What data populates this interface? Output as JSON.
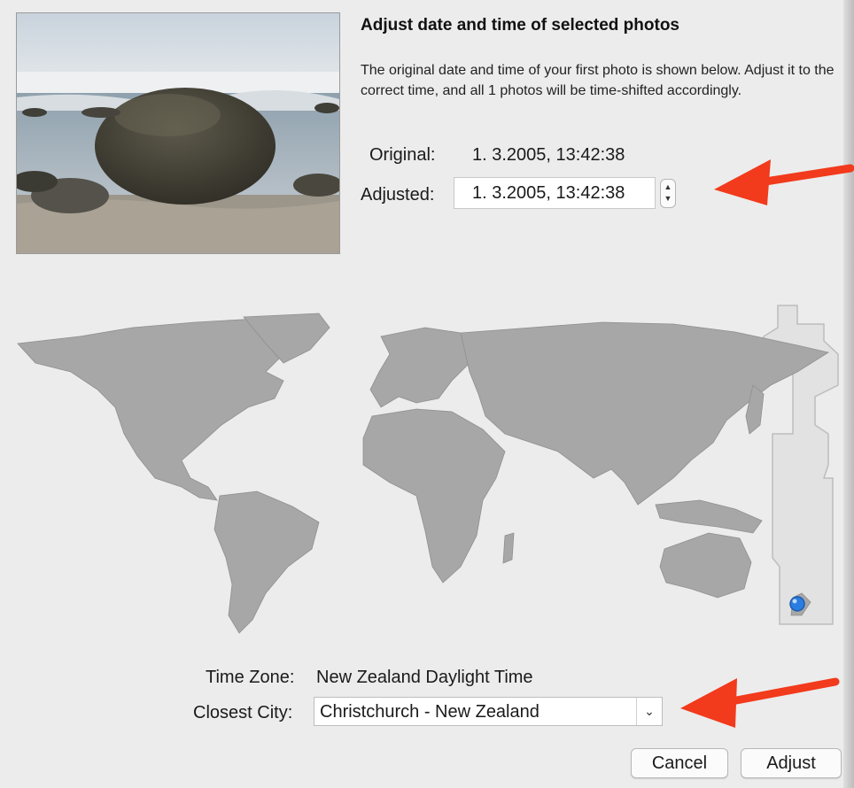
{
  "dialog": {
    "title": "Adjust date and time of selected photos",
    "description": "The original date and time of your first photo is shown below. Adjust it to the correct time, and all 1 photos will be time-shifted accordingly."
  },
  "original": {
    "label": "Original:",
    "value": "1. 3.2005, 13:42:38"
  },
  "adjusted": {
    "label": "Adjusted:",
    "value": "1. 3.2005, 13:42:38"
  },
  "timezone": {
    "label": "Time Zone:",
    "value": "New Zealand Daylight Time"
  },
  "city": {
    "label": "Closest City:",
    "value": "Christchurch - New Zealand"
  },
  "buttons": {
    "cancel": "Cancel",
    "adjust": "Adjust"
  },
  "icons": {
    "stepper": "stepper-up-down-icon",
    "dropdown": "chevron-down-icon",
    "location": "location-pin-icon"
  },
  "colors": {
    "annotation_arrow": "#f23a1c",
    "location_pin": "#2a7de1",
    "land": "#a7a7a7",
    "selected_zone": "#e2e2e2"
  }
}
